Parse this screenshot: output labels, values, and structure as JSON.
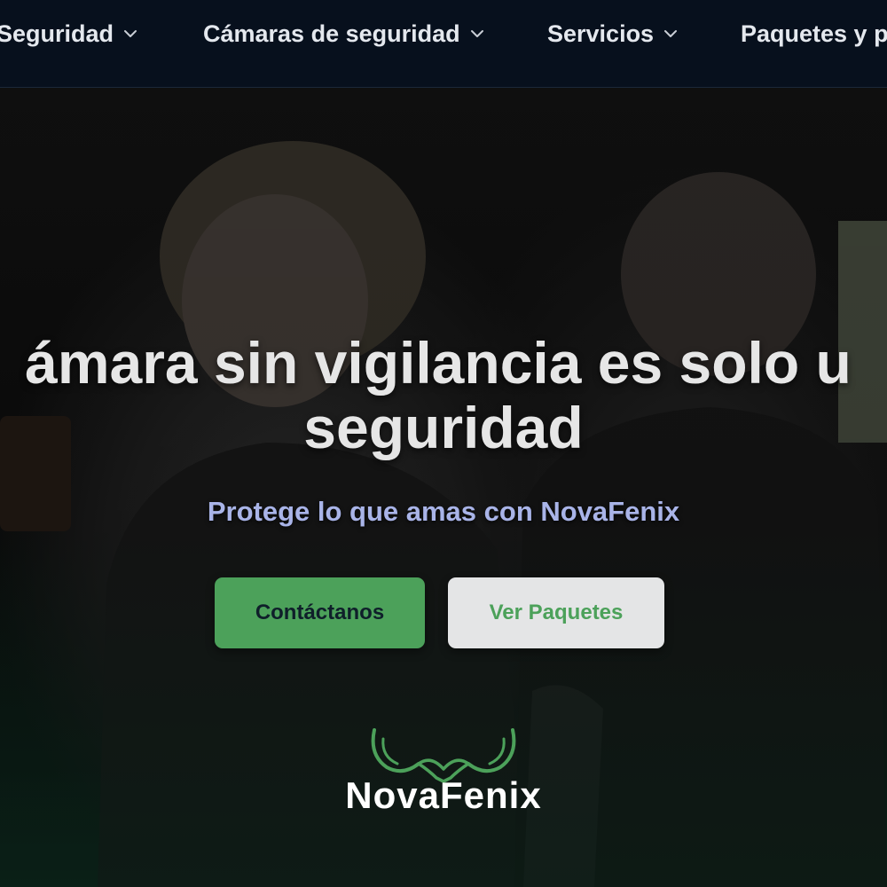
{
  "nav": {
    "items": [
      {
        "label": "Seguridad"
      },
      {
        "label": "Cámaras de seguridad"
      },
      {
        "label": "Servicios"
      },
      {
        "label": "Paquetes y pr"
      }
    ]
  },
  "hero": {
    "headline_line1": "ámara sin vigilancia es solo u",
    "headline_line2": "seguridad",
    "subtitle": "Protege lo que amas con NovaFenix",
    "buttons": {
      "contact_label": "Contáctanos",
      "packages_label": "Ver Paquetes"
    }
  },
  "logo": {
    "text": "NovaFenix",
    "icon": "phoenix-wings-icon"
  },
  "colors": {
    "nav_bg": "#07101d",
    "accent_green": "#4ca15a",
    "subtitle": "#a9b4e8",
    "button_light": "#e4e5e6"
  }
}
